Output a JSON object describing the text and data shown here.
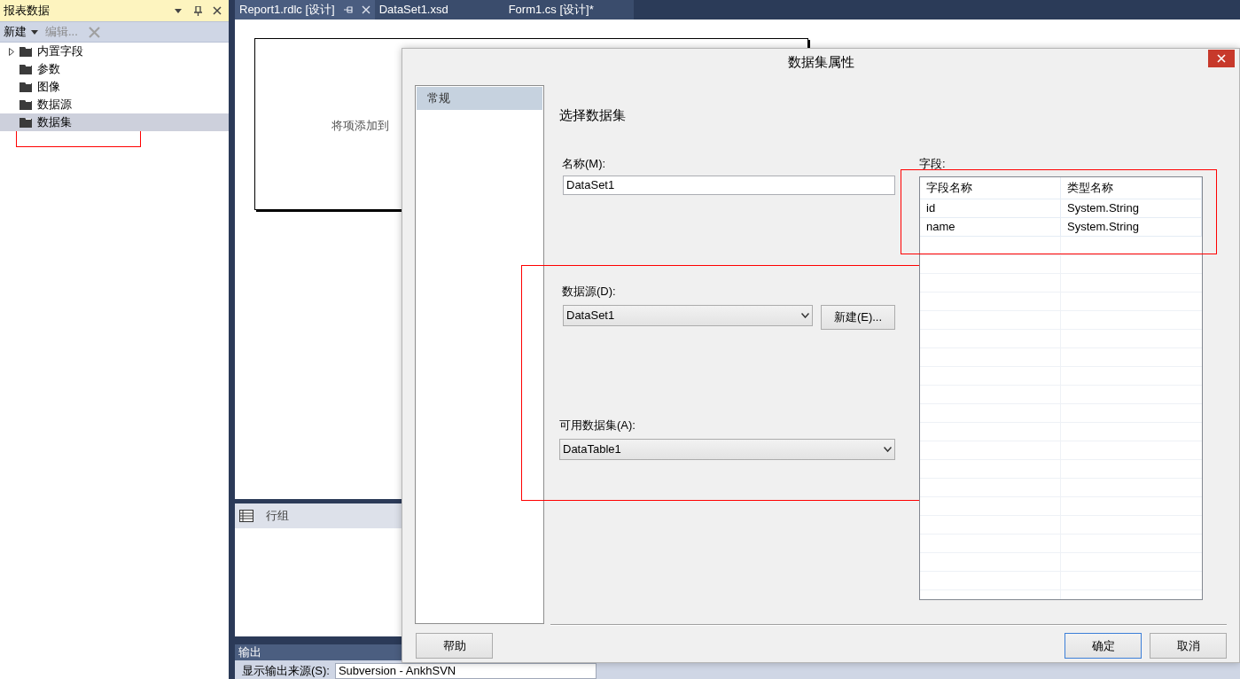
{
  "report_data_panel": {
    "title": "报表数据",
    "toolbar": [
      {
        "label": "新建",
        "kind": "dropdown",
        "disabled": false
      },
      {
        "label": "编辑...",
        "kind": "button",
        "disabled": true
      },
      {
        "kind": "delete",
        "disabled": true
      }
    ],
    "tree": [
      {
        "label": "内置字段",
        "expanded": false,
        "selected": false,
        "highlighted": false
      },
      {
        "label": "参数",
        "selected": false,
        "highlighted": false
      },
      {
        "label": "图像",
        "selected": false,
        "highlighted": false
      },
      {
        "label": "数据源",
        "selected": false,
        "highlighted": false
      },
      {
        "label": "数据集",
        "selected": true,
        "highlighted": true
      }
    ]
  },
  "tabs": [
    {
      "label": "Report1.rdlc [设计]",
      "selected": true
    },
    {
      "label": "DataSet1.xsd",
      "selected": false
    },
    {
      "label": "Form1.cs [设计]*",
      "selected": false
    }
  ],
  "designer": {
    "body_text": "将项添加到"
  },
  "row_groups": {
    "label": "行组"
  },
  "output": {
    "title": "输出",
    "source_label": "显示输出来源(S):",
    "source_value": "Subversion - AnkhSVN"
  },
  "dialog": {
    "title": "数据集属性",
    "nav": [
      {
        "label": "常规",
        "selected": true
      }
    ],
    "heading": "选择数据集",
    "name_label": "名称(M):",
    "name_value": "DataSet1",
    "fields": {
      "label": "字段:",
      "highlighted": true,
      "columns": [
        "字段名称",
        "类型名称"
      ],
      "rows": [
        [
          "id",
          "System.String"
        ],
        [
          "name",
          "System.String"
        ]
      ]
    },
    "source_group": {
      "highlighted": true,
      "source_label": "数据源(D):",
      "source_value": "DataSet1",
      "new_button": "新建(E)...",
      "dataset_label": "可用数据集(A):",
      "dataset_value": "DataTable1"
    },
    "buttons": [
      {
        "label": "帮助",
        "kind": "help",
        "default": false
      },
      {
        "label": "确定",
        "kind": "ok",
        "default": true
      },
      {
        "label": "取消",
        "kind": "cancel",
        "default": false
      }
    ]
  }
}
